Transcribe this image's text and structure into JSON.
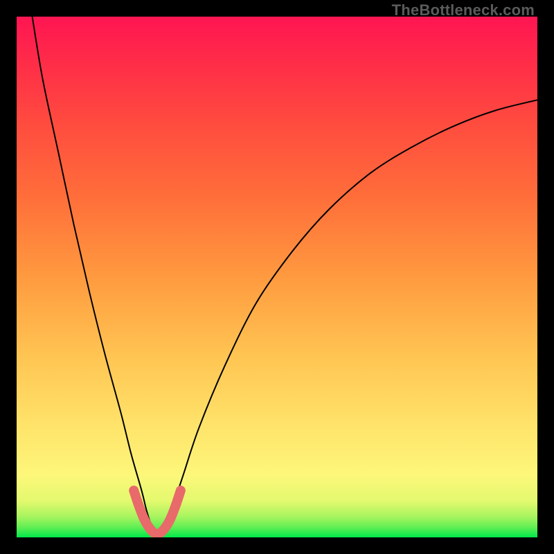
{
  "watermark": "TheBottleneck.com",
  "chart_data": {
    "type": "line",
    "title": "",
    "xlabel": "",
    "ylabel": "",
    "xlim": [
      0,
      100
    ],
    "ylim": [
      0,
      100
    ],
    "notes": "Bottleneck-style V-curve over a vertical green→red gradient. Minimum of the curve sits near x≈27 at y≈0. No axis ticks or labels shown.",
    "gradient_stops": [
      {
        "offset": 0.0,
        "color": "#00e84a"
      },
      {
        "offset": 0.02,
        "color": "#63ef54"
      },
      {
        "offset": 0.04,
        "color": "#a8f45f"
      },
      {
        "offset": 0.07,
        "color": "#e3f96e"
      },
      {
        "offset": 0.12,
        "color": "#fdf77a"
      },
      {
        "offset": 0.22,
        "color": "#ffe269"
      },
      {
        "offset": 0.35,
        "color": "#ffc452"
      },
      {
        "offset": 0.5,
        "color": "#ff9a3f"
      },
      {
        "offset": 0.65,
        "color": "#ff6f3a"
      },
      {
        "offset": 0.8,
        "color": "#ff4a3f"
      },
      {
        "offset": 0.92,
        "color": "#ff2a49"
      },
      {
        "offset": 1.0,
        "color": "#ff1552"
      }
    ],
    "series": [
      {
        "name": "bottleneck-curve",
        "x": [
          3,
          5,
          8,
          11,
          14,
          17,
          20,
          22,
          24,
          25,
          26,
          27,
          28,
          29,
          30,
          32,
          35,
          40,
          46,
          53,
          60,
          68,
          76,
          84,
          92,
          100
        ],
        "y": [
          100,
          88,
          74,
          60,
          47,
          35,
          24,
          16,
          9,
          5,
          2,
          0,
          1,
          3,
          6,
          12,
          21,
          33,
          45,
          55,
          63,
          70,
          75,
          79,
          82,
          84
        ]
      }
    ],
    "highlight": {
      "name": "bottom-u-marker",
      "color": "#e86a6a",
      "stroke_width": 14,
      "x": [
        22.5,
        23.5,
        24.5,
        25.5,
        26.5,
        27.5,
        28.5,
        29.5,
        30.5,
        31.5
      ],
      "y": [
        9,
        6,
        3.5,
        1.8,
        0.8,
        0.8,
        1.8,
        3.5,
        6,
        9
      ]
    }
  }
}
